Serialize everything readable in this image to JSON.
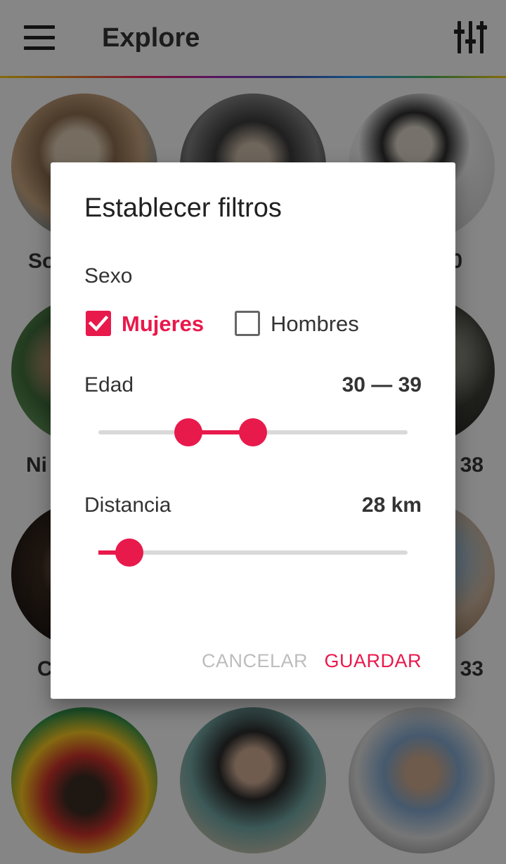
{
  "app": {
    "title": "Explore",
    "profiles": [
      {
        "name": "So",
        "align": "left"
      },
      {
        "name": "",
        "align": "left"
      },
      {
        "name": "0",
        "align": "right"
      },
      {
        "name": "Ni",
        "align": "left"
      },
      {
        "name": "",
        "align": "left"
      },
      {
        "name": "38",
        "align": "right"
      },
      {
        "name": "C",
        "align": "left"
      },
      {
        "name": "",
        "align": "left"
      },
      {
        "name": ", 33",
        "align": "right"
      },
      {
        "name": "",
        "align": "left"
      },
      {
        "name": "",
        "align": "left"
      },
      {
        "name": "",
        "align": "left"
      }
    ]
  },
  "dialog": {
    "title": "Establecer filtros",
    "sex": {
      "label": "Sexo",
      "women": {
        "label": "Mujeres",
        "checked": true
      },
      "men": {
        "label": "Hombres",
        "checked": false
      }
    },
    "age": {
      "label": "Edad",
      "value": "30 — 39",
      "range_low_fraction": 0.29,
      "range_high_fraction": 0.5
    },
    "distance": {
      "label": "Distancia",
      "value": "28 km",
      "fraction": 0.1
    },
    "cancel_label": "CANCELAR",
    "save_label": "GUARDAR"
  },
  "colors": {
    "accent": "#e8194b",
    "disabled_text": "#bdbdbd",
    "track": "#d9d9d9"
  }
}
